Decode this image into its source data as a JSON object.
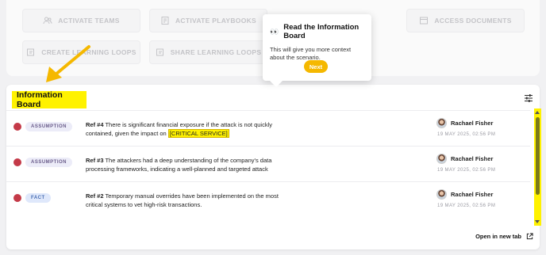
{
  "actions": {
    "row1": [
      {
        "label": "ACTIVATE TEAMS",
        "icon": "people-icon"
      },
      {
        "label": "ACTIVATE PLAYBOOKS",
        "icon": "playbook-icon"
      },
      {
        "label": "ACCESS DOCUMENTS",
        "icon": "document-icon"
      }
    ],
    "row2": [
      {
        "label": "CREATE LEARNING LOOPS",
        "icon": "loop-edit-icon"
      },
      {
        "label": "SHARE LEARNING LOOPS",
        "icon": "loop-share-icon"
      }
    ]
  },
  "tooltip": {
    "title": "Read the Information Board",
    "text": "This will give you more context about the scenario.",
    "next_label": "Next"
  },
  "board": {
    "title": "Information Board",
    "open_tab_label": "Open in new tab",
    "highlight_color": "#fff200",
    "entries": [
      {
        "tag": "ASSUMPTION",
        "ref": "Ref #4",
        "text": "There is significant financial exposure if the attack is not quickly contained, given the impact on",
        "highlight": "[CRITICAL SERVICE]",
        "author": "Rachael Fisher",
        "timestamp": "19 MAY 2025, 02:56 PM"
      },
      {
        "tag": "ASSUMPTION",
        "ref": "Ref #3",
        "text": "The attackers had a deep understanding of the company's data processing frameworks, indicating a well-planned and targeted attack",
        "highlight": "",
        "author": "Rachael Fisher",
        "timestamp": "19 MAY 2025, 02:56 PM"
      },
      {
        "tag": "FACT",
        "ref": "Ref #2",
        "text": "Temporary manual overrides have been implemented on the most critical systems to vet high-risk transactions.",
        "highlight": "",
        "author": "Rachael Fisher",
        "timestamp": "19 MAY 2025, 02:56 PM"
      }
    ]
  },
  "colors": {
    "accent": "#f5b800",
    "status_dot": "#c43a48"
  }
}
